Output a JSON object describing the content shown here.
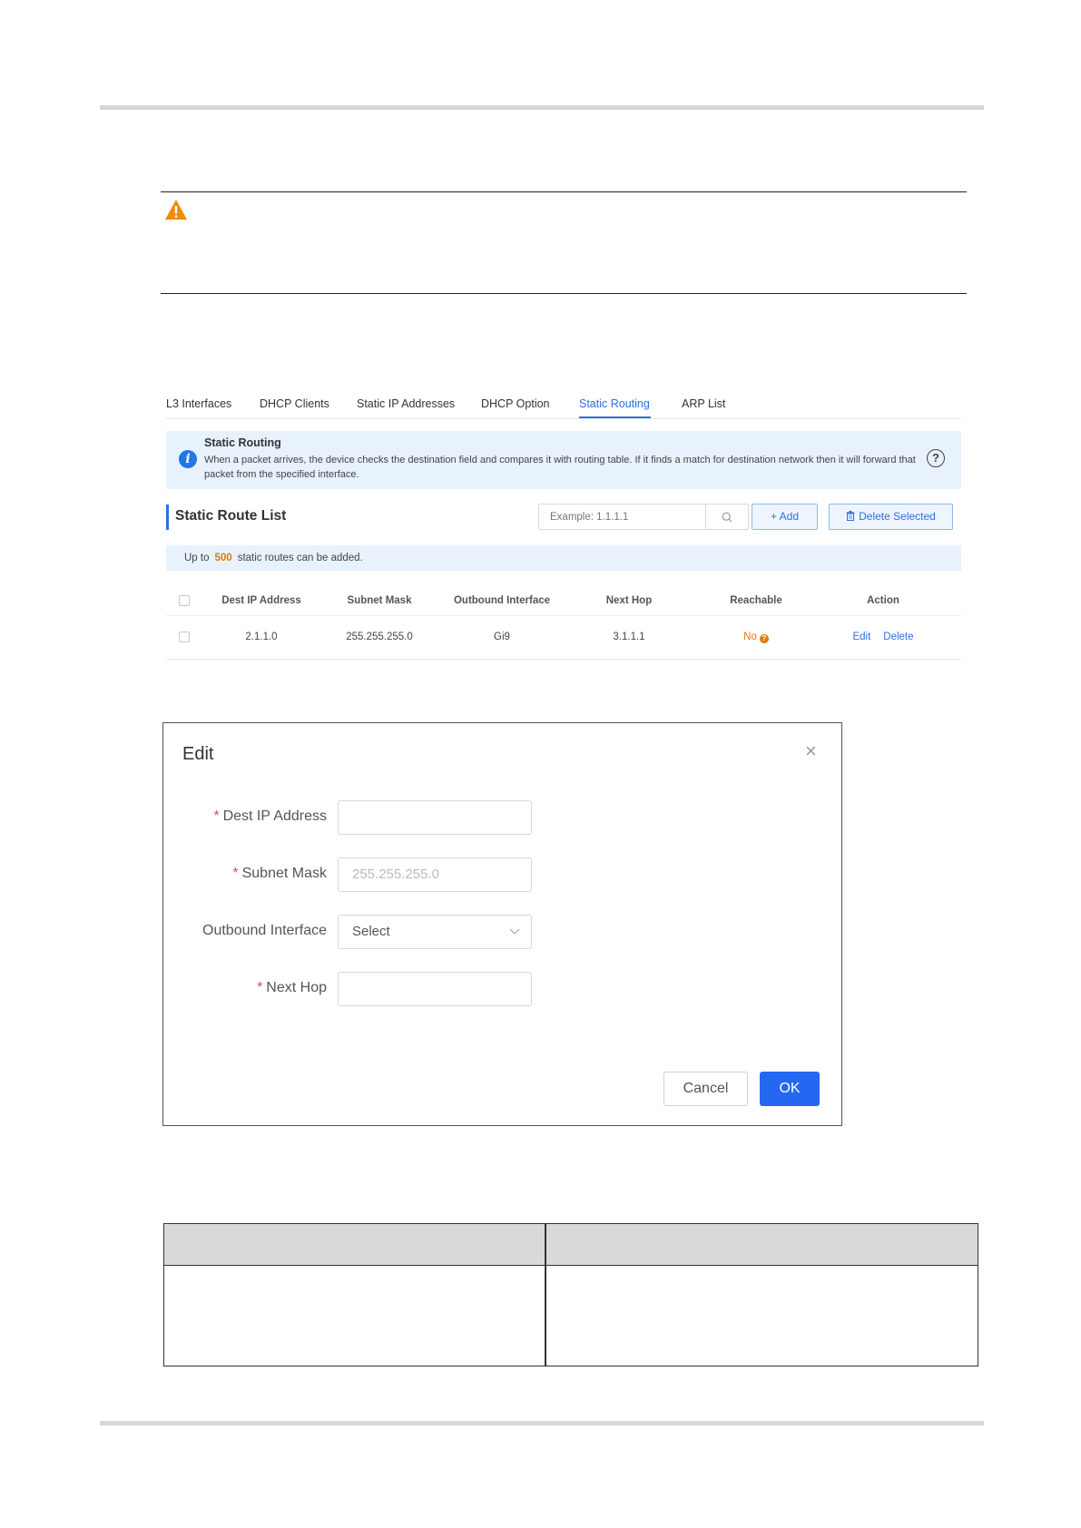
{
  "tabs": [
    {
      "label": "L3 Interfaces"
    },
    {
      "label": "DHCP Clients"
    },
    {
      "label": "Static IP Addresses"
    },
    {
      "label": "DHCP Option"
    },
    {
      "label": "Static Routing"
    },
    {
      "label": "ARP List"
    }
  ],
  "active_tab": "Static Routing",
  "info": {
    "title": "Static Routing",
    "description": "When a packet arrives, the device checks the destination field and compares it with routing table. If it finds a match for destination network then it will forward that packet from the specified interface."
  },
  "list": {
    "title": "Static Route List",
    "search_placeholder": "Example: 1.1.1.1",
    "add_label": "+ Add",
    "delete_selected_label": "Delete Selected",
    "limit_prefix": "Up to",
    "limit_value": "500",
    "limit_suffix": "static routes can be added."
  },
  "table": {
    "columns": [
      "Dest IP Address",
      "Subnet Mask",
      "Outbound Interface",
      "Next Hop",
      "Reachable",
      "Action"
    ],
    "rows": [
      {
        "dest_ip": "2.1.1.0",
        "subnet_mask": "255.255.255.0",
        "interface": "Gi9",
        "next_hop": "3.1.1.1",
        "reachable": "No",
        "edit": "Edit",
        "delete": "Delete"
      }
    ]
  },
  "dialog": {
    "title": "Edit",
    "required_mark": "*",
    "fields": {
      "dest_ip_label": "Dest IP Address",
      "dest_ip_value": "",
      "subnet_mask_label": "Subnet Mask",
      "subnet_mask_placeholder": "255.255.255.0",
      "interface_label": "Outbound Interface",
      "interface_value": "Select",
      "next_hop_label": "Next Hop",
      "next_hop_value": ""
    },
    "cancel_label": "Cancel",
    "ok_label": "OK"
  },
  "colors": {
    "accent": "#2f6fe0",
    "primary_button": "#2468f2",
    "warning": "#e07b00",
    "info_bg": "#e7f2fd"
  }
}
